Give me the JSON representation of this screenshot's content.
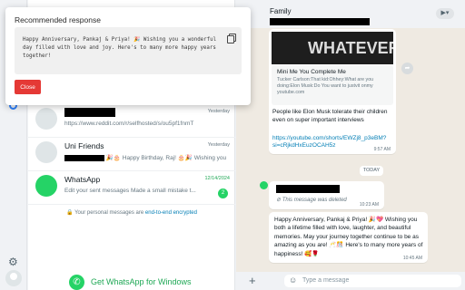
{
  "popup": {
    "title": "Recommended response",
    "response": "Happy Anniversary, Pankaj & Priya! 🎉 Wishing you a wonderful day filled with love and joy. Here's to many more happy years together!",
    "close_label": "Close"
  },
  "chat_list": {
    "rows": [
      {
        "time": "Yesterday",
        "message": "https://www.reddit.com/r/selfhosted/s/ou5pf1fnmT"
      },
      {
        "name": "Uni Friends",
        "time": "Yesterday",
        "message": "🎉🎂 Happy Birthday, Raj! 🎂🎉 Wishing you"
      },
      {
        "name": "WhatsApp",
        "time": "12/14/2024",
        "message": "Edit your sent messages Made a small mistake t...",
        "badge": "2"
      }
    ],
    "encryption_note": "Your personal messages are",
    "encryption_link": "end-to-end encrypted",
    "get_app": "Get WhatsApp for Windows"
  },
  "conversation": {
    "title": "Family",
    "link_preview": {
      "image_text": "WHATEVER",
      "title": "Mini Me You Complete Me",
      "description": "Tucker Carlson:That kid:Ohhey:What are you doing:Elon Musk:Do You want to justvit onmy youtube.com"
    },
    "msg1_text": "People like Elon Musk tolerate their children even on super important interviews",
    "msg1_link": "https://youtube.com/shorts/EWZj8_p3eBM?si=cRjkdHxEuzOCAH5z",
    "msg1_time": "9:57 AM",
    "date_divider": "TODAY",
    "deleted_text": "This message was deleted",
    "deleted_time": "10:23 AM",
    "msg3_text": "Happy Anniversary, Pankaj & Priya! 🎉💖 Wishing you both a lifetime filled with love, laughter, and beautiful memories. May your journey together continue to be as amazing as you are! 🥂🎊 Here's to many more years of happiness! 🥰🌹",
    "msg3_time": "10:45 AM",
    "composer_placeholder": "Type a message"
  }
}
